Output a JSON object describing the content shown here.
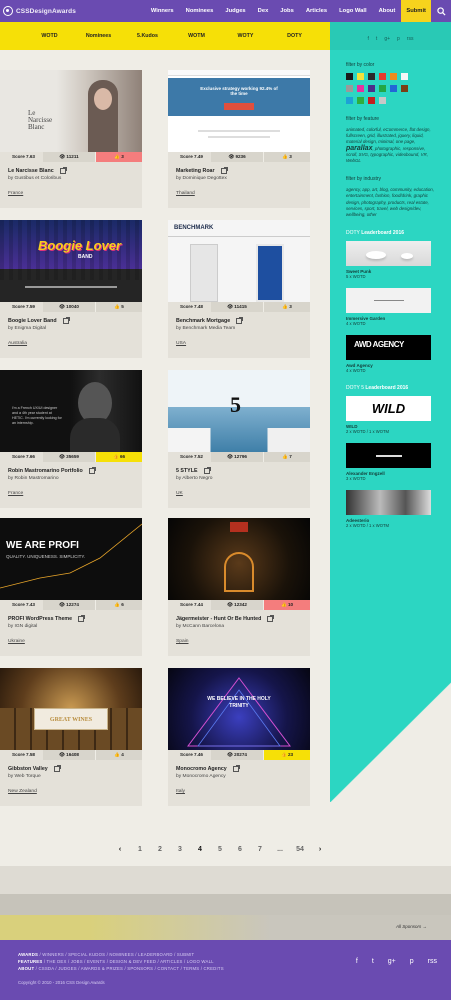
{
  "brand": {
    "name_bold": "CSS",
    "name_rest": "DesignAwards"
  },
  "nav": {
    "items": [
      "Winners",
      "Nominees",
      "Judges",
      "Dex",
      "Jobs",
      "Articles",
      "Logo Wall",
      "About"
    ],
    "submit": "Submit"
  },
  "tabs": [
    "WOTD",
    "Nominees",
    "5.Kudos",
    "WOTM",
    "WOTY",
    "DOTY"
  ],
  "sidebar": {
    "social": [
      "f",
      "t",
      "g+",
      "p",
      "rss"
    ],
    "filter_color": "filter by color",
    "colors": [
      "#1a1a1a",
      "#f3e13a",
      "#2b2b2b",
      "#e63a2e",
      "#eb8b1f",
      "#f6f6f6",
      "#9a9a9a",
      "#e62fa0",
      "#4b2f8a",
      "#22a745",
      "#2266d6",
      "#7a3f15",
      "#1da1d6",
      "#2fae3c",
      "#c31f1f",
      "#c8c8c8"
    ],
    "filter_feature": "filter by feature",
    "feature_tags_before": "animated, colorful, eCommerce, flat design, fullscreen, grid, illustrated, jquery, liquid, material design, minimal, one page",
    "feature_big": "parallax",
    "feature_tags_after": ", photographic, responsive, scroll, SVG, typographic, videobound, VR, WebGL",
    "filter_industry": "filter by industry",
    "industry_tags": "agency, app, art, blog, community, education, entertainment, fashion, food/drink, graphic design, photography, products, real estate, services, sport, travel, web design/dev, wellbeing, other",
    "lb1_head_pre": "DOTY",
    "lb1_head_bold": "Leaderboard 2016",
    "lb1": [
      {
        "name": "Sweet Punk",
        "meta": "5 x WOTD"
      },
      {
        "name": "Immersive Garden",
        "meta": "4 x WOTD"
      },
      {
        "name": "Awd Agency",
        "meta": "4 x WOTD"
      }
    ],
    "lb2_head_pre": "DOTY 5",
    "lb2_head_bold": "Leaderboard 2016",
    "lb2": [
      {
        "name": "WILD",
        "meta": "2 x WOTD / 1 x WOTM"
      },
      {
        "name": "Alexander Engzell",
        "meta": "3 x WOTD"
      },
      {
        "name": "Adeesterio",
        "meta": "2 x WOTD / 1 x WOTM"
      }
    ],
    "lb_logos": {
      "awd": "AWD AGENCY",
      "wild": "WILD"
    }
  },
  "cards": [
    {
      "title": "Le Narcisse Blanc",
      "by": "by Gustibus et Coloribus",
      "country": "France",
      "score": "Score 7.63",
      "views": "11211",
      "likes": "3"
    },
    {
      "title": "Marketing Roar",
      "by": "by Dominique Degottex",
      "country": "Thailand",
      "score": "Score 7.49",
      "views": "9236",
      "likes": "3"
    },
    {
      "title": "Boogie Lover Band",
      "by": "by Enigma Digital",
      "country": "Australia",
      "score": "Score 7.59",
      "views": "10040",
      "likes": "5"
    },
    {
      "title": "Benchmark Mortgage",
      "by": "by Benchmark Media Team",
      "country": "USA",
      "score": "Score 7.48",
      "views": "11415",
      "likes": "3"
    },
    {
      "title": "Robin Mastromarino Portfolio",
      "by": "by Robin Mastromarino",
      "country": "France",
      "score": "Score 7.66",
      "views": "35659",
      "likes": "66"
    },
    {
      "title": "5 STYLE",
      "by": "by Alberto Negro",
      "country": "UK",
      "score": "Score 7.52",
      "views": "12796",
      "likes": "7"
    },
    {
      "title": "PROFI WordPress Theme",
      "by": "by IGN digital",
      "country": "Ukraine",
      "score": "Score 7.43",
      "views": "12274",
      "likes": "6"
    },
    {
      "title": "Jägermeister - Hunt Or Be Hunted",
      "by": "by McCann Barcelona",
      "country": "Spain",
      "score": "Score 7.44",
      "views": "12342",
      "likes": "10"
    },
    {
      "title": "Gibbston Valley",
      "by": "by Web Torque",
      "country": "New Zealand",
      "score": "Score 7.58",
      "views": "16408",
      "likes": "4"
    },
    {
      "title": "Monocromo Agency",
      "by": "by Monocromo Agency",
      "country": "Italy",
      "score": "Score 7.46",
      "views": "20274",
      "likes": "23"
    }
  ],
  "thumbs": {
    "narcisse": "Le Narcisse Blanc",
    "roar_head": "Exclusive strategy working 92.4% of the time",
    "boogie": "Boogie Lover",
    "boogie_band": "BAND",
    "bench": "BENCHMARK",
    "robin": "I'm a French UX/UI designer and a 4th year student at HETIC. I'm currently looking for an internship.",
    "five": "5",
    "profi": "WE ARE PROFI",
    "profi_sub": "QUALITY. UNIQUENESS. SIMPLICITY.",
    "gib": "GREAT WINES",
    "mono": "WE BELIEVE IN THE HOLY TRINITY"
  },
  "pager": {
    "prev": "‹",
    "pages": [
      "1",
      "2",
      "3",
      "4",
      "5",
      "6",
      "7",
      "...",
      "54"
    ],
    "current": "4",
    "next": "›"
  },
  "all_sponsors": "All Sponsors →",
  "footer": {
    "awards": "AWARDS",
    "awards_links": " / WINNERS / SPECIAL KUDOS / NOMINEES / LEADERBOARD / SUBMIT",
    "features": "FEATURES",
    "features_links": " / THE DEX / JOBS / EVENTS / DESIGN & DEV FEED / ARTICLES / LOGO WALL",
    "about": "ABOUT",
    "about_links": " / CSSDA / JUDGES / AWARDS & PRIZES / SPONSORS / CONTACT / TERMS / CREDITS",
    "copyright": "Copyright © 2010 - 2016 CSS Design Awards",
    "social": [
      "f",
      "t",
      "g+",
      "p",
      "rss"
    ]
  }
}
